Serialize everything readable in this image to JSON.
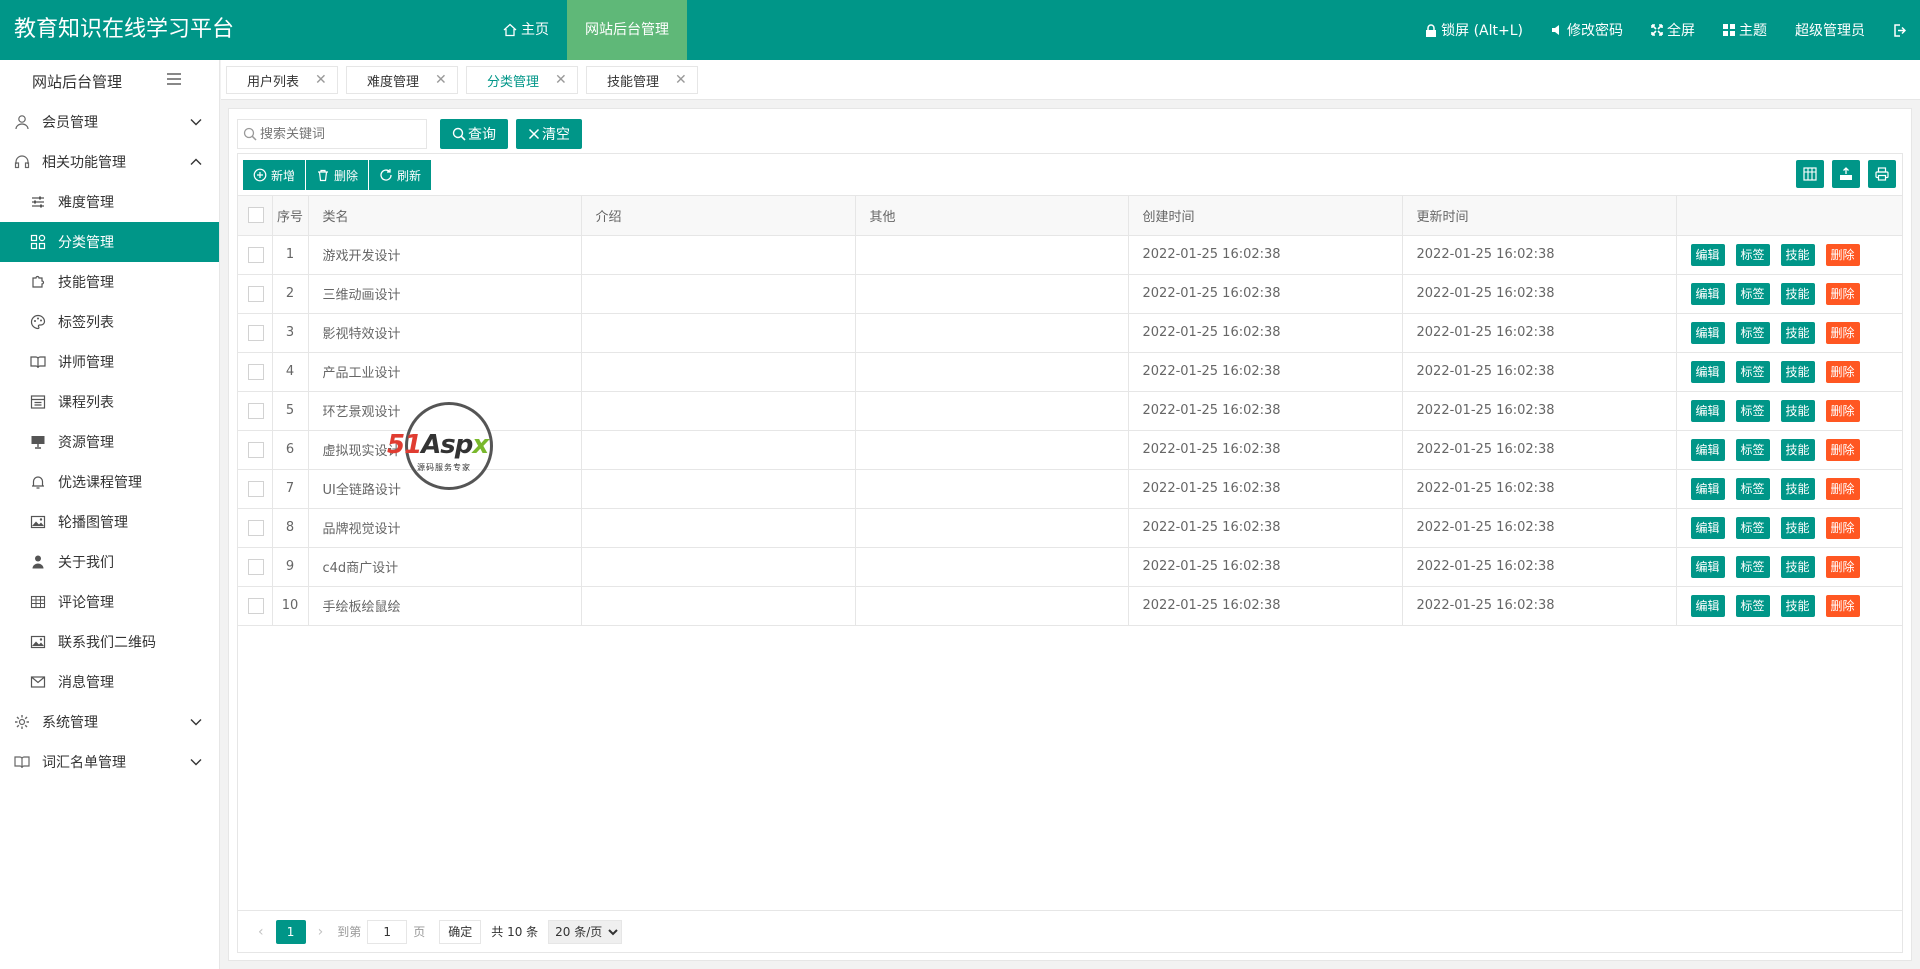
{
  "app": {
    "title": "教育知识在线学习平台"
  },
  "topnav": {
    "home": "主页",
    "admin": "网站后台管理"
  },
  "topright": {
    "lock": "锁屏 (Alt+L)",
    "password": "修改密码",
    "fullscreen": "全屏",
    "theme": "主题",
    "user": "超级管理员"
  },
  "sidebar": {
    "title": "网站后台管理",
    "groups": [
      {
        "label": "会员管理",
        "icon": "user-icon",
        "expanded": false
      },
      {
        "label": "相关功能管理",
        "icon": "headset-icon",
        "expanded": true
      },
      {
        "label": "系统管理",
        "icon": "gear-icon",
        "expanded": false
      },
      {
        "label": "词汇名单管理",
        "icon": "book-icon",
        "expanded": false
      }
    ],
    "items": [
      {
        "label": "难度管理",
        "icon": "sliders-icon"
      },
      {
        "label": "分类管理",
        "icon": "apps-icon",
        "active": true
      },
      {
        "label": "技能管理",
        "icon": "puzzle-icon"
      },
      {
        "label": "标签列表",
        "icon": "palette-icon"
      },
      {
        "label": "讲师管理",
        "icon": "book-icon"
      },
      {
        "label": "课程列表",
        "icon": "list-icon"
      },
      {
        "label": "资源管理",
        "icon": "monitor-icon"
      },
      {
        "label": "优选课程管理",
        "icon": "bell-icon"
      },
      {
        "label": "轮播图管理",
        "icon": "image-icon"
      },
      {
        "label": "关于我们",
        "icon": "person-icon"
      },
      {
        "label": "评论管理",
        "icon": "table-icon"
      },
      {
        "label": "联系我们二维码",
        "icon": "image-icon"
      },
      {
        "label": "消息管理",
        "icon": "mail-icon"
      }
    ]
  },
  "tabs": [
    {
      "label": "用户列表",
      "active": false
    },
    {
      "label": "难度管理",
      "active": false
    },
    {
      "label": "分类管理",
      "active": true
    },
    {
      "label": "技能管理",
      "active": false
    }
  ],
  "search": {
    "placeholder": "搜索关键词",
    "query_button": "查询",
    "clear_button": "清空"
  },
  "toolbar": {
    "add": "新增",
    "delete": "删除",
    "refresh": "刷新"
  },
  "table": {
    "headers": {
      "num": "序号",
      "name": "类名",
      "intro": "介绍",
      "other": "其他",
      "created": "创建时间",
      "updated": "更新时间"
    },
    "actions": {
      "edit": "编辑",
      "tag": "标签",
      "skill": "技能",
      "delete": "删除"
    },
    "rows": [
      {
        "num": "1",
        "name": "游戏开发设计",
        "intro": "",
        "other": "",
        "created": "2022-01-25 16:02:38",
        "updated": "2022-01-25 16:02:38"
      },
      {
        "num": "2",
        "name": "三维动画设计",
        "intro": "",
        "other": "",
        "created": "2022-01-25 16:02:38",
        "updated": "2022-01-25 16:02:38"
      },
      {
        "num": "3",
        "name": "影视特效设计",
        "intro": "",
        "other": "",
        "created": "2022-01-25 16:02:38",
        "updated": "2022-01-25 16:02:38"
      },
      {
        "num": "4",
        "name": "产品工业设计",
        "intro": "",
        "other": "",
        "created": "2022-01-25 16:02:38",
        "updated": "2022-01-25 16:02:38"
      },
      {
        "num": "5",
        "name": "环艺景观设计",
        "intro": "",
        "other": "",
        "created": "2022-01-25 16:02:38",
        "updated": "2022-01-25 16:02:38"
      },
      {
        "num": "6",
        "name": "虚拟现实设计",
        "intro": "",
        "other": "",
        "created": "2022-01-25 16:02:38",
        "updated": "2022-01-25 16:02:38"
      },
      {
        "num": "7",
        "name": "UI全链路设计",
        "intro": "",
        "other": "",
        "created": "2022-01-25 16:02:38",
        "updated": "2022-01-25 16:02:38"
      },
      {
        "num": "8",
        "name": "品牌视觉设计",
        "intro": "",
        "other": "",
        "created": "2022-01-25 16:02:38",
        "updated": "2022-01-25 16:02:38"
      },
      {
        "num": "9",
        "name": "c4d商广设计",
        "intro": "",
        "other": "",
        "created": "2022-01-25 16:02:38",
        "updated": "2022-01-25 16:02:38"
      },
      {
        "num": "10",
        "name": "手绘板绘鼠绘",
        "intro": "",
        "other": "",
        "created": "2022-01-25 16:02:38",
        "updated": "2022-01-25 16:02:38"
      }
    ]
  },
  "pager": {
    "current_page": "1",
    "goto_label": "到第",
    "goto_value": "1",
    "page_label": "页",
    "ok_button": "确定",
    "total": "共 10 条",
    "page_size": "20 条/页",
    "prev_arrow": "‹",
    "next_arrow": "›"
  },
  "watermark": {
    "brand_51": "51",
    "brand_asp": "Asp",
    "brand_x": "x",
    "subtitle": "源码服务专家"
  },
  "colors": {
    "primary": "#009688",
    "active_nav": "#5fb878",
    "danger": "#ff5722"
  }
}
